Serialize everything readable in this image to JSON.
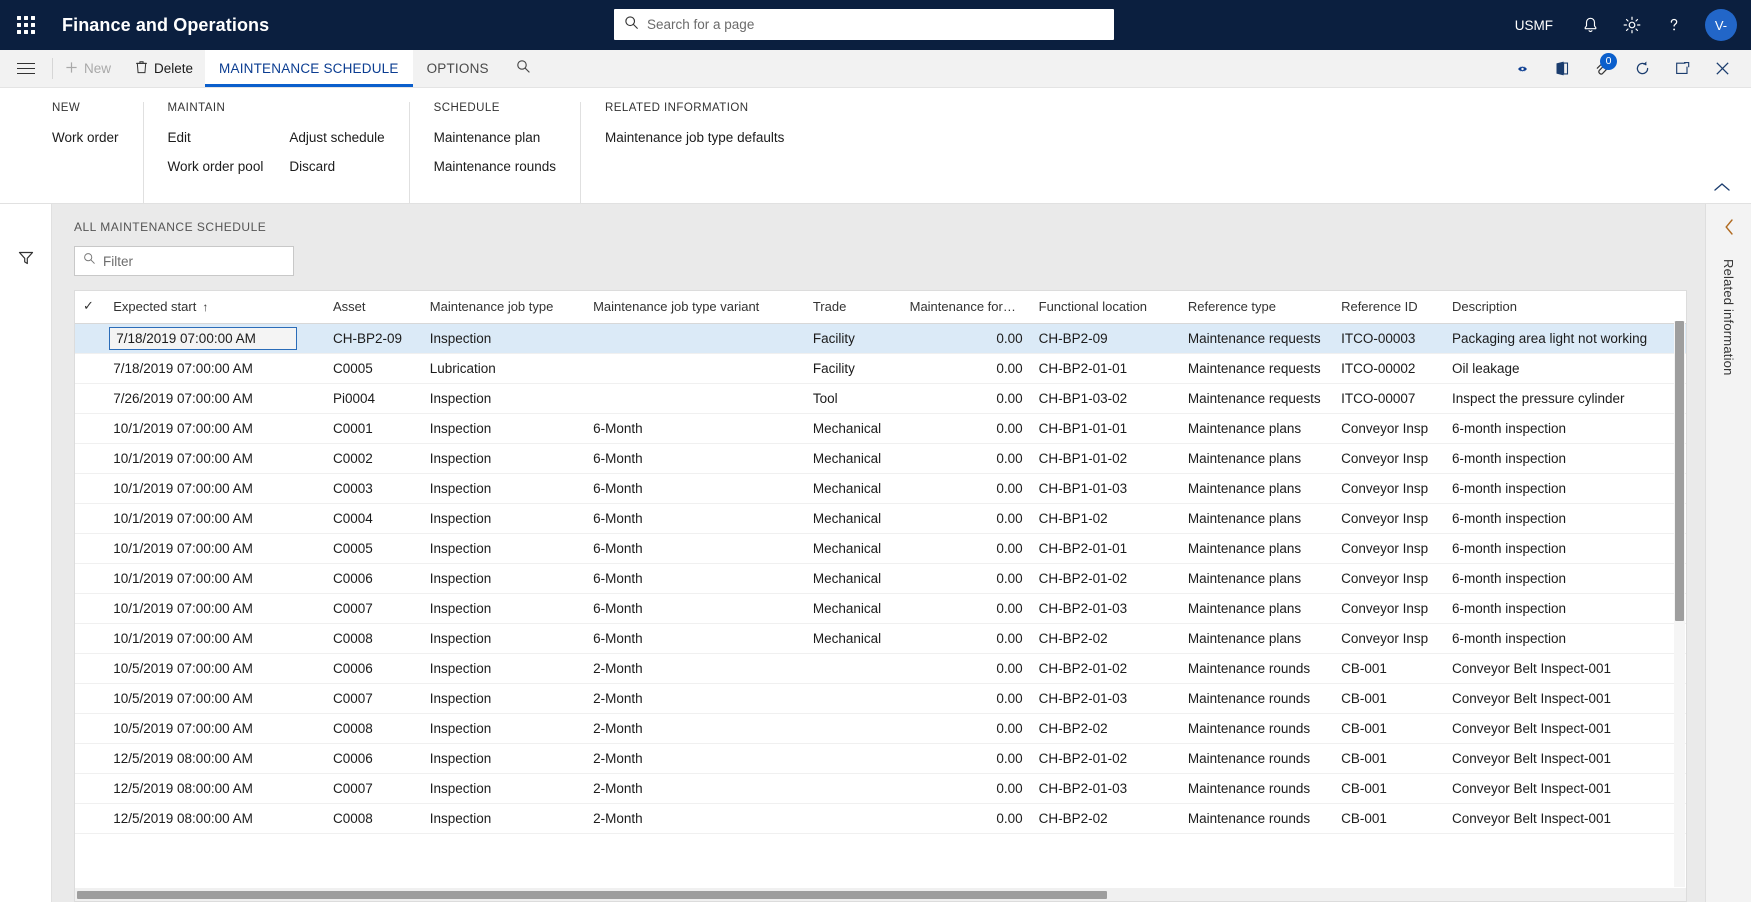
{
  "topbar": {
    "waffle_icon": "waffle-grid-icon",
    "app_title": "Finance and Operations",
    "search_placeholder": "Search for a page",
    "search_value": "",
    "search_icon": "search-icon",
    "company": "USMF",
    "notifications_icon": "bell-icon",
    "settings_icon": "gear-icon",
    "help_icon": "question-mark-icon",
    "avatar_initials": "V-"
  },
  "commandbar": {
    "menu_icon": "hamburger-icon",
    "new_label": "New",
    "new_icon": "plus-icon",
    "delete_label": "Delete",
    "delete_icon": "trash-icon",
    "tabs": [
      {
        "label": "MAINTENANCE SCHEDULE",
        "active": true
      },
      {
        "label": "OPTIONS",
        "active": false
      }
    ],
    "search_icon": "search-icon",
    "right_icons": [
      {
        "name": "share-icon",
        "badge": null
      },
      {
        "name": "open-in-office-icon",
        "badge": null
      },
      {
        "name": "attachment-icon",
        "badge": "0"
      },
      {
        "name": "refresh-icon",
        "badge": null
      },
      {
        "name": "popout-icon",
        "badge": null
      },
      {
        "name": "close-icon",
        "badge": null
      }
    ]
  },
  "actionpane": {
    "collapse_icon": "chevron-up-icon",
    "groups": [
      {
        "title": "NEW",
        "columns": [
          {
            "items": [
              "Work order"
            ]
          }
        ]
      },
      {
        "title": "MAINTAIN",
        "columns": [
          {
            "items": [
              "Edit",
              "Work order pool"
            ]
          },
          {
            "items": [
              "Adjust schedule",
              "Discard"
            ]
          }
        ]
      },
      {
        "title": "SCHEDULE",
        "columns": [
          {
            "items": [
              "Maintenance plan",
              "Maintenance rounds"
            ]
          }
        ]
      },
      {
        "title": "RELATED INFORMATION",
        "columns": [
          {
            "items": [
              "Maintenance job type defaults"
            ]
          }
        ]
      }
    ]
  },
  "leftrail": {
    "filter_icon": "filter-funnel-icon"
  },
  "rightrail": {
    "collapse_icon": "chevron-left-icon",
    "label": "Related information"
  },
  "list": {
    "caption": "ALL MAINTENANCE SCHEDULE",
    "filter_placeholder": "Filter",
    "filter_value": "",
    "filter_icon": "search-icon",
    "select_all_icon": "checkmark-icon",
    "sort_indicator": "↑",
    "columns": [
      "Expected start",
      "Asset",
      "Maintenance job type",
      "Maintenance job type variant",
      "Trade",
      "Maintenance forecast...",
      "Functional location",
      "Reference type",
      "Reference ID",
      "Description"
    ],
    "rows": [
      {
        "selected": true,
        "editing": true,
        "expected_start": "7/18/2019 07:00:00 AM",
        "asset": "CH-BP2-09",
        "asset_link": true,
        "job_type": "Inspection",
        "job_type_link": true,
        "variant": "",
        "trade": "Facility",
        "trade_link": true,
        "forecast": "0.00",
        "functional_location": "CH-BP2-09",
        "functional_location_link": true,
        "reference_type": "Maintenance requests",
        "reference_id": "ITCO-00003",
        "description": "Packaging area light not working"
      },
      {
        "selected": false,
        "editing": false,
        "expected_start": "7/18/2019 07:00:00 AM",
        "asset": "C0005",
        "asset_link": false,
        "job_type": "Lubrication",
        "job_type_link": false,
        "variant": "",
        "trade": "Facility",
        "trade_link": false,
        "forecast": "0.00",
        "functional_location": "CH-BP2-01-01",
        "functional_location_link": false,
        "reference_type": "Maintenance requests",
        "reference_id": "ITCO-00002",
        "description": "Oil leakage"
      },
      {
        "selected": false,
        "editing": false,
        "expected_start": "7/26/2019 07:00:00 AM",
        "asset": "Pi0004",
        "asset_link": false,
        "job_type": "Inspection",
        "job_type_link": false,
        "variant": "",
        "trade": "Tool",
        "trade_link": false,
        "forecast": "0.00",
        "functional_location": "CH-BP1-03-02",
        "functional_location_link": false,
        "reference_type": "Maintenance requests",
        "reference_id": "ITCO-00007",
        "description": "Inspect the pressure cylinder"
      },
      {
        "selected": false,
        "editing": false,
        "expected_start": "10/1/2019 07:00:00 AM",
        "asset": "C0001",
        "asset_link": false,
        "job_type": "Inspection",
        "job_type_link": false,
        "variant": "6-Month",
        "trade": "Mechanical",
        "trade_link": false,
        "forecast": "0.00",
        "functional_location": "CH-BP1-01-01",
        "functional_location_link": false,
        "reference_type": "Maintenance plans",
        "reference_id": "Conveyor Insp",
        "description": "6-month inspection"
      },
      {
        "selected": false,
        "editing": false,
        "expected_start": "10/1/2019 07:00:00 AM",
        "asset": "C0002",
        "asset_link": false,
        "job_type": "Inspection",
        "job_type_link": false,
        "variant": "6-Month",
        "trade": "Mechanical",
        "trade_link": false,
        "forecast": "0.00",
        "functional_location": "CH-BP1-01-02",
        "functional_location_link": false,
        "reference_type": "Maintenance plans",
        "reference_id": "Conveyor Insp",
        "description": "6-month inspection"
      },
      {
        "selected": false,
        "editing": false,
        "expected_start": "10/1/2019 07:00:00 AM",
        "asset": "C0003",
        "asset_link": false,
        "job_type": "Inspection",
        "job_type_link": false,
        "variant": "6-Month",
        "trade": "Mechanical",
        "trade_link": false,
        "forecast": "0.00",
        "functional_location": "CH-BP1-01-03",
        "functional_location_link": false,
        "reference_type": "Maintenance plans",
        "reference_id": "Conveyor Insp",
        "description": "6-month inspection"
      },
      {
        "selected": false,
        "editing": false,
        "expected_start": "10/1/2019 07:00:00 AM",
        "asset": "C0004",
        "asset_link": false,
        "job_type": "Inspection",
        "job_type_link": false,
        "variant": "6-Month",
        "trade": "Mechanical",
        "trade_link": false,
        "forecast": "0.00",
        "functional_location": "CH-BP1-02",
        "functional_location_link": false,
        "reference_type": "Maintenance plans",
        "reference_id": "Conveyor Insp",
        "description": "6-month inspection"
      },
      {
        "selected": false,
        "editing": false,
        "expected_start": "10/1/2019 07:00:00 AM",
        "asset": "C0005",
        "asset_link": false,
        "job_type": "Inspection",
        "job_type_link": false,
        "variant": "6-Month",
        "trade": "Mechanical",
        "trade_link": false,
        "forecast": "0.00",
        "functional_location": "CH-BP2-01-01",
        "functional_location_link": false,
        "reference_type": "Maintenance plans",
        "reference_id": "Conveyor Insp",
        "description": "6-month inspection"
      },
      {
        "selected": false,
        "editing": false,
        "expected_start": "10/1/2019 07:00:00 AM",
        "asset": "C0006",
        "asset_link": false,
        "job_type": "Inspection",
        "job_type_link": false,
        "variant": "6-Month",
        "trade": "Mechanical",
        "trade_link": false,
        "forecast": "0.00",
        "functional_location": "CH-BP2-01-02",
        "functional_location_link": false,
        "reference_type": "Maintenance plans",
        "reference_id": "Conveyor Insp",
        "description": "6-month inspection"
      },
      {
        "selected": false,
        "editing": false,
        "expected_start": "10/1/2019 07:00:00 AM",
        "asset": "C0007",
        "asset_link": false,
        "job_type": "Inspection",
        "job_type_link": false,
        "variant": "6-Month",
        "trade": "Mechanical",
        "trade_link": false,
        "forecast": "0.00",
        "functional_location": "CH-BP2-01-03",
        "functional_location_link": false,
        "reference_type": "Maintenance plans",
        "reference_id": "Conveyor Insp",
        "description": "6-month inspection"
      },
      {
        "selected": false,
        "editing": false,
        "expected_start": "10/1/2019 07:00:00 AM",
        "asset": "C0008",
        "asset_link": false,
        "job_type": "Inspection",
        "job_type_link": false,
        "variant": "6-Month",
        "trade": "Mechanical",
        "trade_link": false,
        "forecast": "0.00",
        "functional_location": "CH-BP2-02",
        "functional_location_link": false,
        "reference_type": "Maintenance plans",
        "reference_id": "Conveyor Insp",
        "description": "6-month inspection"
      },
      {
        "selected": false,
        "editing": false,
        "expected_start": "10/5/2019 07:00:00 AM",
        "asset": "C0006",
        "asset_link": false,
        "job_type": "Inspection",
        "job_type_link": false,
        "variant": "2-Month",
        "trade": "",
        "trade_link": false,
        "forecast": "0.00",
        "functional_location": "CH-BP2-01-02",
        "functional_location_link": false,
        "reference_type": "Maintenance rounds",
        "reference_id": "CB-001",
        "description": "Conveyor Belt Inspect-001"
      },
      {
        "selected": false,
        "editing": false,
        "expected_start": "10/5/2019 07:00:00 AM",
        "asset": "C0007",
        "asset_link": false,
        "job_type": "Inspection",
        "job_type_link": false,
        "variant": "2-Month",
        "trade": "",
        "trade_link": false,
        "forecast": "0.00",
        "functional_location": "CH-BP2-01-03",
        "functional_location_link": false,
        "reference_type": "Maintenance rounds",
        "reference_id": "CB-001",
        "description": "Conveyor Belt Inspect-001"
      },
      {
        "selected": false,
        "editing": false,
        "expected_start": "10/5/2019 07:00:00 AM",
        "asset": "C0008",
        "asset_link": false,
        "job_type": "Inspection",
        "job_type_link": false,
        "variant": "2-Month",
        "trade": "",
        "trade_link": false,
        "forecast": "0.00",
        "functional_location": "CH-BP2-02",
        "functional_location_link": false,
        "reference_type": "Maintenance rounds",
        "reference_id": "CB-001",
        "description": "Conveyor Belt Inspect-001"
      },
      {
        "selected": false,
        "editing": false,
        "expected_start": "12/5/2019 08:00:00 AM",
        "asset": "C0006",
        "asset_link": false,
        "job_type": "Inspection",
        "job_type_link": false,
        "variant": "2-Month",
        "trade": "",
        "trade_link": false,
        "forecast": "0.00",
        "functional_location": "CH-BP2-01-02",
        "functional_location_link": false,
        "reference_type": "Maintenance rounds",
        "reference_id": "CB-001",
        "description": "Conveyor Belt Inspect-001"
      },
      {
        "selected": false,
        "editing": false,
        "expected_start": "12/5/2019 08:00:00 AM",
        "asset": "C0007",
        "asset_link": false,
        "job_type": "Inspection",
        "job_type_link": false,
        "variant": "2-Month",
        "trade": "",
        "trade_link": false,
        "forecast": "0.00",
        "functional_location": "CH-BP2-01-03",
        "functional_location_link": false,
        "reference_type": "Maintenance rounds",
        "reference_id": "CB-001",
        "description": "Conveyor Belt Inspect-001"
      },
      {
        "selected": false,
        "editing": false,
        "expected_start": "12/5/2019 08:00:00 AM",
        "asset": "C0008",
        "asset_link": false,
        "job_type": "Inspection",
        "job_type_link": false,
        "variant": "2-Month",
        "trade": "",
        "trade_link": false,
        "forecast": "0.00",
        "functional_location": "CH-BP2-02",
        "functional_location_link": false,
        "reference_type": "Maintenance rounds",
        "reference_id": "CB-001",
        "description": "Conveyor Belt Inspect-001"
      }
    ]
  },
  "colors": {
    "topbar_bg": "#0b1f3f",
    "accent": "#0b5fcc",
    "link": "#1566c0",
    "selected_row": "#dbeaf7",
    "page_bg": "#eaeaea"
  }
}
